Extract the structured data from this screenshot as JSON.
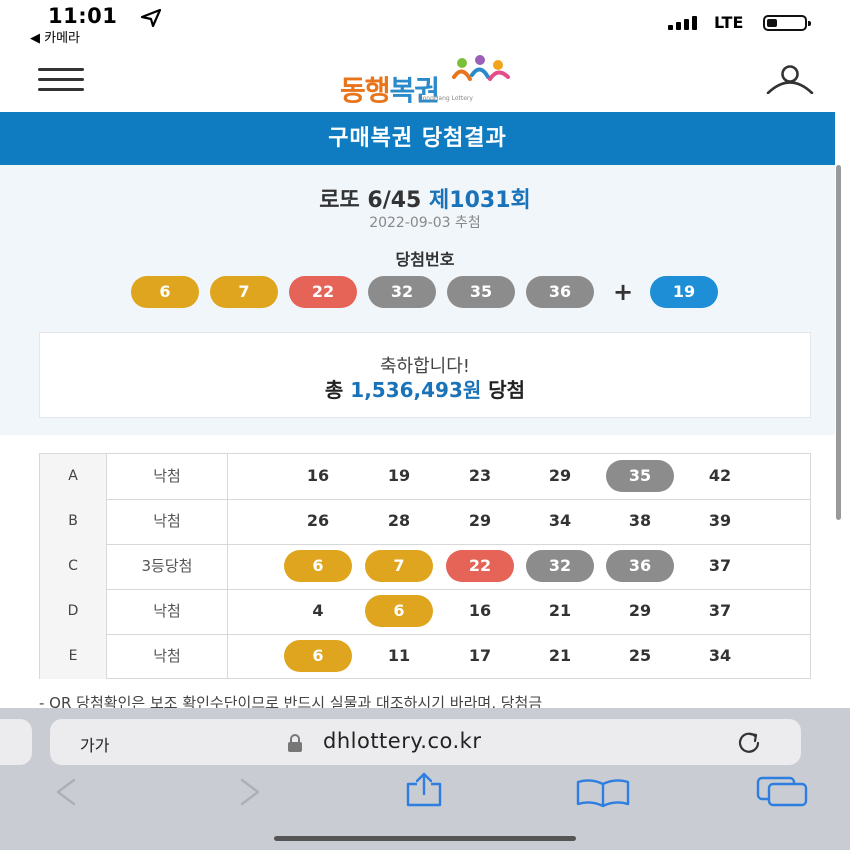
{
  "status": {
    "time": "11:01",
    "back_app": "◀ 카메라",
    "network": "LTE"
  },
  "header": {
    "logo_text_a": "동행",
    "logo_text_b": "복권",
    "logo_sub": "DongHang Lottery"
  },
  "page_title": "구매복권 당첨결과",
  "result": {
    "game": "로또 6/45",
    "round": "제1031회",
    "draw_date": "2022-09-03 추첨",
    "win_label": "당첨번호",
    "numbers": [
      {
        "value": "6",
        "color": "#e0a51e"
      },
      {
        "value": "7",
        "color": "#e0a51e"
      },
      {
        "value": "22",
        "color": "#e66357"
      },
      {
        "value": "32",
        "color": "#8c8c8c"
      },
      {
        "value": "35",
        "color": "#8c8c8c"
      },
      {
        "value": "36",
        "color": "#8c8c8c"
      }
    ],
    "plus": "+",
    "bonus": {
      "value": "19",
      "color": "#1e8fd6"
    },
    "congrats": "축하합니다!",
    "total_prefix": "총",
    "total_amount": "1,536,493원",
    "total_suffix": "당첨"
  },
  "tickets": [
    {
      "letter": "A",
      "result": "낙첨",
      "nums": [
        {
          "n": "16"
        },
        {
          "n": "19"
        },
        {
          "n": "23"
        },
        {
          "n": "29"
        },
        {
          "n": "35",
          "color": "#8c8c8c"
        },
        {
          "n": "42"
        }
      ]
    },
    {
      "letter": "B",
      "result": "낙첨",
      "nums": [
        {
          "n": "26"
        },
        {
          "n": "28"
        },
        {
          "n": "29"
        },
        {
          "n": "34"
        },
        {
          "n": "38"
        },
        {
          "n": "39"
        }
      ]
    },
    {
      "letter": "C",
      "result": "3등당첨",
      "nums": [
        {
          "n": "6",
          "color": "#e0a51e"
        },
        {
          "n": "7",
          "color": "#e0a51e"
        },
        {
          "n": "22",
          "color": "#e66357"
        },
        {
          "n": "32",
          "color": "#8c8c8c"
        },
        {
          "n": "36",
          "color": "#8c8c8c"
        },
        {
          "n": "37"
        }
      ]
    },
    {
      "letter": "D",
      "result": "낙첨",
      "nums": [
        {
          "n": "4"
        },
        {
          "n": "6",
          "color": "#e0a51e"
        },
        {
          "n": "16"
        },
        {
          "n": "21"
        },
        {
          "n": "29"
        },
        {
          "n": "37"
        }
      ]
    },
    {
      "letter": "E",
      "result": "낙첨",
      "nums": [
        {
          "n": "6",
          "color": "#e0a51e"
        },
        {
          "n": "11"
        },
        {
          "n": "17"
        },
        {
          "n": "21"
        },
        {
          "n": "25"
        },
        {
          "n": "34"
        }
      ]
    }
  ],
  "notice": "- QR 당첨확인은 보조 확인수단이므로 반드시 실물과 대조하시기 바라며, 당첨금",
  "browser": {
    "aa_label": "가가",
    "url": "dhlottery.co.kr"
  },
  "colors": {
    "brand_blue": "#0f7cc2",
    "accent_orange": "#e8741b"
  }
}
